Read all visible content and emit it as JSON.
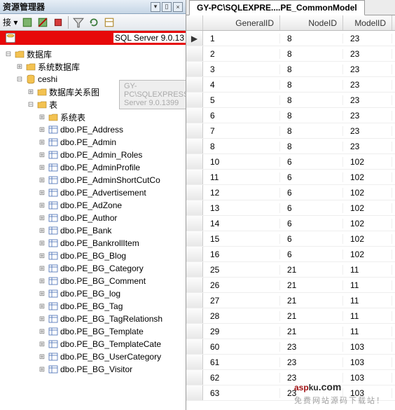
{
  "panel_title": "资源管理器",
  "panel_left_label": "接 ▾",
  "server_version_tail": "SQL Server 9.0.13",
  "ghost_text": "GY-PC\\SQLEXPRESS\\SQL Server 9.0.1399",
  "tree": {
    "root": "数据库",
    "sysdb": "系统数据库",
    "userdb": "ceshi",
    "diagrams": "数据库关系图",
    "tables_node": "表",
    "systables": "系统表",
    "tables": [
      "dbo.PE_Address",
      "dbo.PE_Admin",
      "dbo.PE_Admin_Roles",
      "dbo.PE_AdminProfile",
      "dbo.PE_AdminShortCutCo",
      "dbo.PE_Advertisement",
      "dbo.PE_AdZone",
      "dbo.PE_Author",
      "dbo.PE_Bank",
      "dbo.PE_BankrollItem",
      "dbo.PE_BG_Blog",
      "dbo.PE_BG_Category",
      "dbo.PE_BG_Comment",
      "dbo.PE_BG_log",
      "dbo.PE_BG_Tag",
      "dbo.PE_BG_TagRelationsh",
      "dbo.PE_BG_Template",
      "dbo.PE_BG_TemplateCate",
      "dbo.PE_BG_UserCategory",
      "dbo.PE_BG_Visitor"
    ]
  },
  "tab_title": "GY-PC\\SQLEXPRE....PE_CommonModel",
  "columns": [
    "GeneralID",
    "NodeID",
    "ModelID"
  ],
  "chart_data": {
    "type": "table",
    "title": "PE_CommonModel",
    "columns": [
      "GeneralID",
      "NodeID",
      "ModelID"
    ],
    "rows": [
      [
        1,
        8,
        23
      ],
      [
        2,
        8,
        23
      ],
      [
        3,
        8,
        23
      ],
      [
        4,
        8,
        23
      ],
      [
        5,
        8,
        23
      ],
      [
        6,
        8,
        23
      ],
      [
        7,
        8,
        23
      ],
      [
        8,
        8,
        23
      ],
      [
        10,
        6,
        102
      ],
      [
        11,
        6,
        102
      ],
      [
        12,
        6,
        102
      ],
      [
        13,
        6,
        102
      ],
      [
        14,
        6,
        102
      ],
      [
        15,
        6,
        102
      ],
      [
        16,
        6,
        102
      ],
      [
        25,
        21,
        11
      ],
      [
        26,
        21,
        11
      ],
      [
        27,
        21,
        11
      ],
      [
        28,
        21,
        11
      ],
      [
        29,
        21,
        11
      ],
      [
        60,
        23,
        103
      ],
      [
        61,
        23,
        103
      ],
      [
        62,
        23,
        103
      ],
      [
        63,
        23,
        103
      ]
    ]
  },
  "watermark": {
    "a": "asp",
    "b": "ku",
    "c": ".com",
    "sub": "免费网站源码下载站！"
  }
}
